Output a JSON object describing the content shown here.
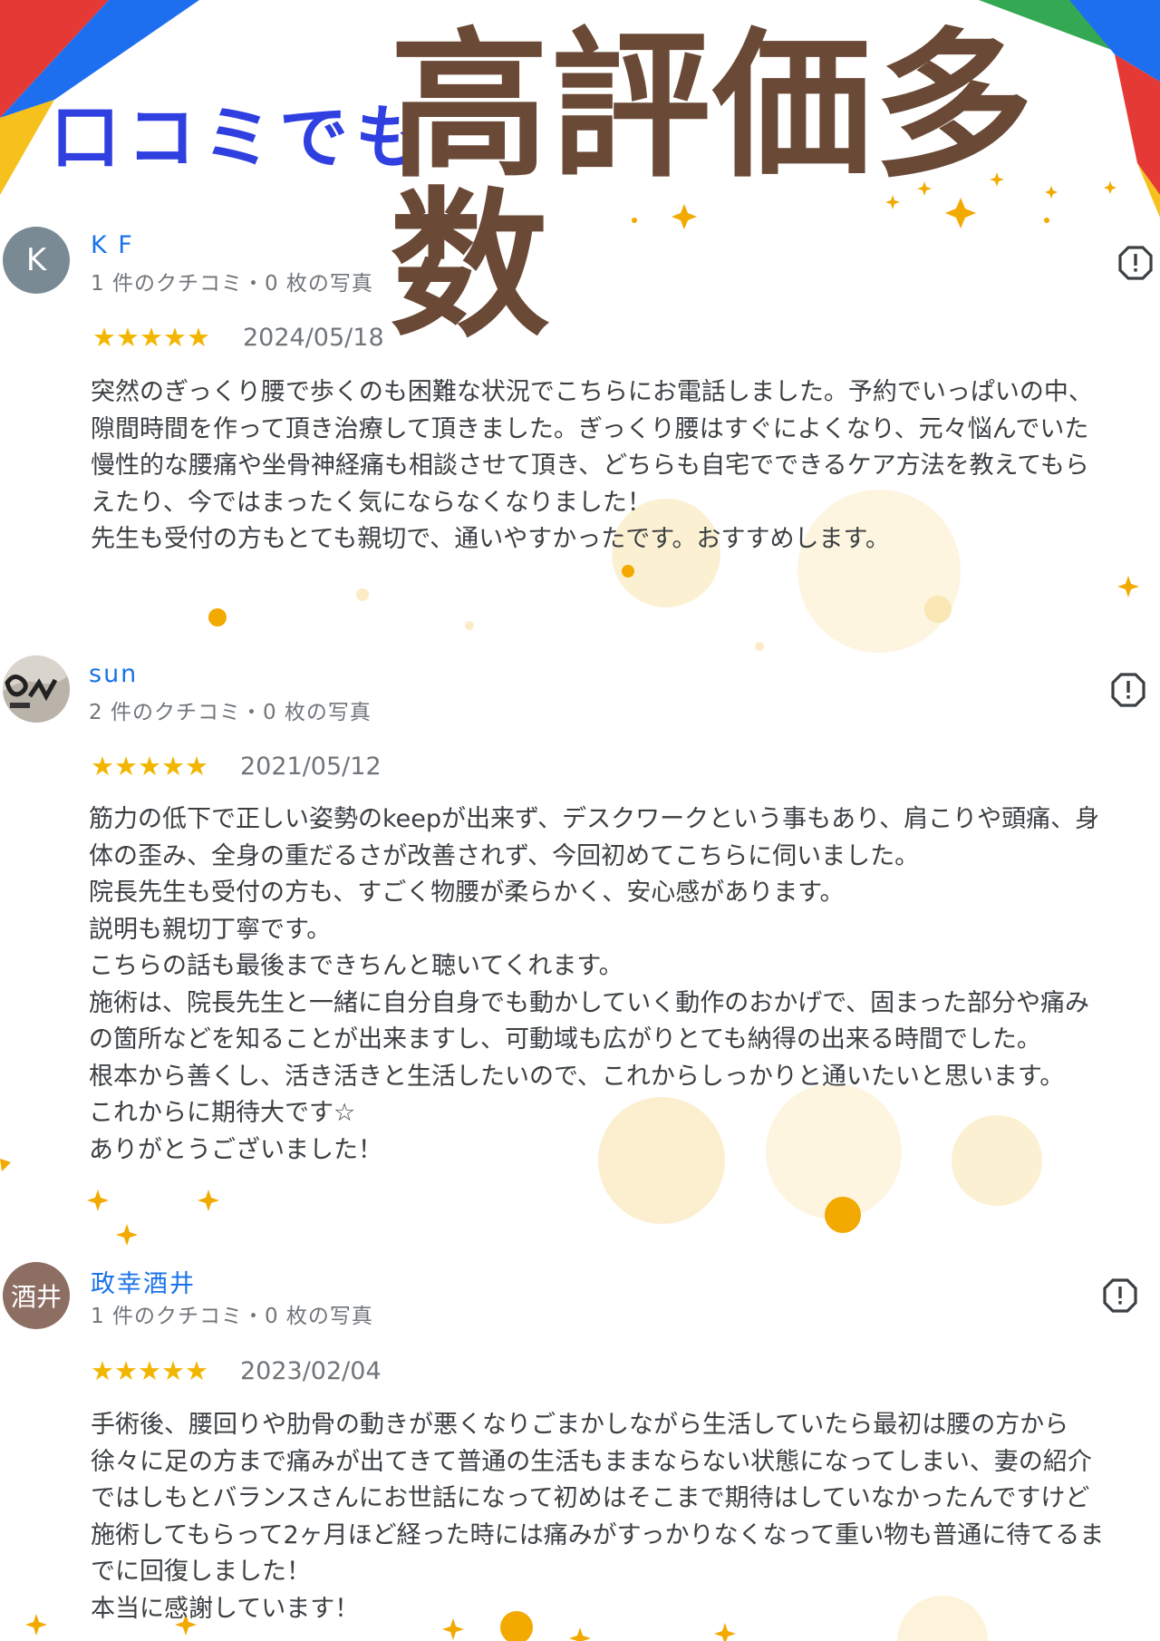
{
  "header": {
    "subtitle": "口コミでも",
    "title": "高評価多数"
  },
  "colors": {
    "subtitle": "#2f3fe0",
    "title": "#6a4a37",
    "name_link": "#1a73e8",
    "star": "#f2b600",
    "meta": "#70757a",
    "text": "#3c4043",
    "corner_red": "#e53935",
    "corner_blue": "#1e6ff0",
    "corner_yellow": "#f6c11c",
    "corner_green": "#34a853"
  },
  "reviews": [
    {
      "avatar_text": "K",
      "avatar_color": "#7a8a94",
      "name": "K F",
      "meta": "1 件のクチコミ・0 枚の写真",
      "stars": "★★★★★",
      "rating": 5,
      "date": "2024/05/18",
      "text": "突然のぎっくり腰で歩くのも困難な状況でこちらにお電話しました。予約でいっぱいの中、\n隙間時間を作って頂き治療して頂きました。ぎっくり腰はすぐによくなり、元々悩んでいた\n慢性的な腰痛や坐骨神経痛も相談させて頂き、どちらも自宅でできるケア方法を教えてもら\nえたり、今ではまったく気にならなくなりました！\n先生も受付の方もとても親切で、通いやすかったです。おすすめします。"
    },
    {
      "avatar_text": "",
      "avatar_color": "#cfcac2",
      "name": "sun",
      "meta": "2 件のクチコミ・0 枚の写真",
      "stars": "★★★★★",
      "rating": 5,
      "date": "2021/05/12",
      "text": "筋力の低下で正しい姿勢のkeepが出来ず、デスクワークという事もあり、肩こりや頭痛、身\n体の歪み、全身の重だるさが改善されず、今回初めてこちらに伺いました。\n院長先生も受付の方も、すごく物腰が柔らかく、安心感があります。\n説明も親切丁寧です。\nこちらの話も最後まできちんと聴いてくれます。\n施術は、院長先生と一緒に自分自身でも動かしていく動作のおかげで、固まった部分や痛み\nの箇所などを知ることが出来ますし、可動域も広がりとても納得の出来る時間でした。\n根本から善くし、活き活きと生活したいので、これからしっかりと通いたいと思います。\nこれからに期待大です☆\nありがとうございました！"
    },
    {
      "avatar_text": "酒井",
      "avatar_color": "#8d6e63",
      "name": "政幸酒井",
      "meta": "1 件のクチコミ・0 枚の写真",
      "stars": "★★★★★",
      "rating": 5,
      "date": "2023/02/04",
      "text": "手術後、腰回りや肋骨の動きが悪くなりごまかしながら生活していたら最初は腰の方から\n徐々に足の方まで痛みが出てきて普通の生活もままならない状態になってしまい、妻の紹介\nではしもとバランスさんにお世話になって初めはそこまで期待はしていなかったんですけど\n施術してもらって2ヶ月ほど経った時には痛みがすっかりなくなって重い物も普通に待てるま\nでに回復しました！\n本当に感謝しています！"
    }
  ]
}
